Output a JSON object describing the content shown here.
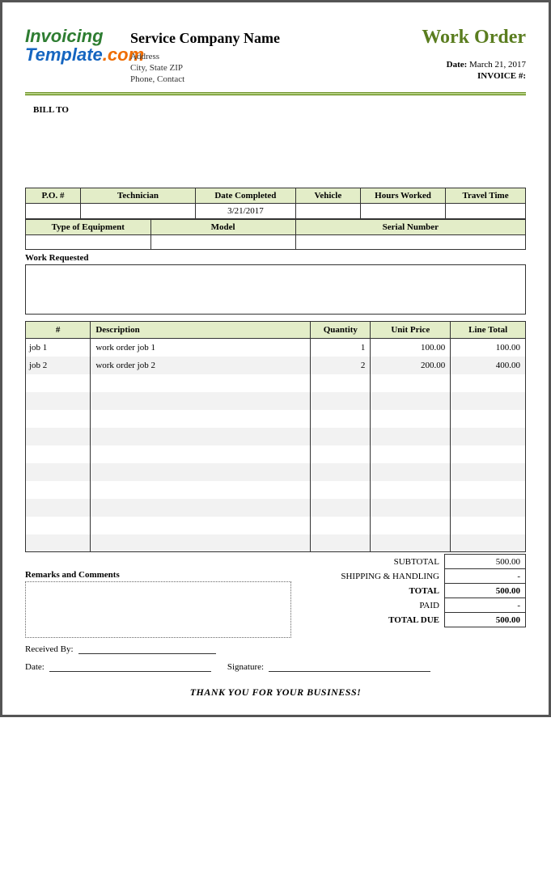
{
  "logo": {
    "line1": "Invoicing",
    "line2": "Template",
    "line3": ".com"
  },
  "company": {
    "name": "Service Company Name",
    "address": "Address",
    "city_state_zip": "City, State ZIP",
    "phone_contact": "Phone, Contact"
  },
  "doc_title": "Work Order",
  "meta": {
    "date_label": "Date:",
    "date_value": "March 21, 2017",
    "invoice_label": "INVOICE #:",
    "invoice_value": ""
  },
  "bill_to_label": "BILL TO",
  "info1": {
    "headers": [
      "P.O. #",
      "Technician",
      "Date Completed",
      "Vehicle",
      "Hours Worked",
      "Travel Time"
    ],
    "values": [
      "",
      "",
      "3/21/2017",
      "",
      "",
      ""
    ]
  },
  "info2": {
    "headers": [
      "Type of Equipment",
      "Model",
      "Serial Number"
    ],
    "values": [
      "",
      "",
      ""
    ]
  },
  "work_requested_label": "Work Requested",
  "items": {
    "headers": [
      "#",
      "Description",
      "Quantity",
      "Unit Price",
      "Line Total"
    ],
    "rows": [
      {
        "num": "job 1",
        "desc": "work order job 1",
        "qty": "1",
        "price": "100.00",
        "total": "100.00"
      },
      {
        "num": "job 2",
        "desc": "work order job 2",
        "qty": "2",
        "price": "200.00",
        "total": "400.00"
      },
      {
        "num": "",
        "desc": "",
        "qty": "",
        "price": "",
        "total": ""
      },
      {
        "num": "",
        "desc": "",
        "qty": "",
        "price": "",
        "total": ""
      },
      {
        "num": "",
        "desc": "",
        "qty": "",
        "price": "",
        "total": ""
      },
      {
        "num": "",
        "desc": "",
        "qty": "",
        "price": "",
        "total": ""
      },
      {
        "num": "",
        "desc": "",
        "qty": "",
        "price": "",
        "total": ""
      },
      {
        "num": "",
        "desc": "",
        "qty": "",
        "price": "",
        "total": ""
      },
      {
        "num": "",
        "desc": "",
        "qty": "",
        "price": "",
        "total": ""
      },
      {
        "num": "",
        "desc": "",
        "qty": "",
        "price": "",
        "total": ""
      },
      {
        "num": "",
        "desc": "",
        "qty": "",
        "price": "",
        "total": ""
      },
      {
        "num": "",
        "desc": "",
        "qty": "",
        "price": "",
        "total": ""
      }
    ]
  },
  "remarks_label": "Remarks and Comments",
  "totals": [
    {
      "label": "SUBTOTAL",
      "value": "500.00",
      "bold": false
    },
    {
      "label": "SHIPPING & HANDLING",
      "value": "-",
      "bold": false
    },
    {
      "label": "TOTAL",
      "value": "500.00",
      "bold": true
    },
    {
      "label": "PAID",
      "value": "-",
      "bold": false
    },
    {
      "label": "TOTAL DUE",
      "value": "500.00",
      "bold": true
    }
  ],
  "signatures": {
    "received_by": "Received By:",
    "date": "Date:",
    "signature": "Signature:"
  },
  "thank_you": "THANK YOU FOR YOUR BUSINESS!"
}
